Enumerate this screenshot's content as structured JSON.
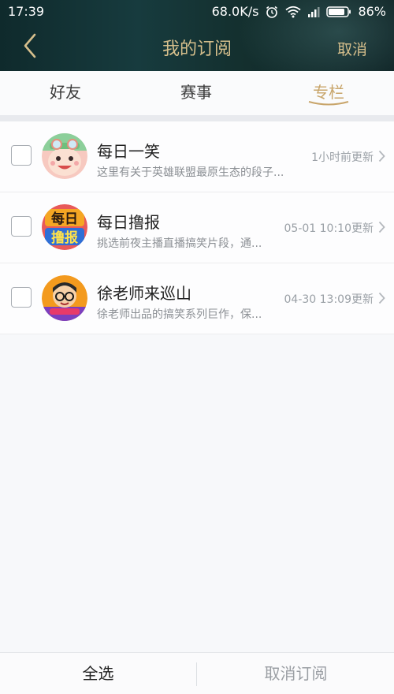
{
  "status_bar": {
    "time": "17:39",
    "network_speed": "68.0K/s",
    "battery": "86%",
    "icons": [
      "alarm-icon",
      "wifi-icon",
      "signal-icon",
      "battery-icon"
    ]
  },
  "header": {
    "title": "我的订阅",
    "cancel_label": "取消",
    "back_icon": "chevron-left-icon"
  },
  "tabs": [
    {
      "label": "好友",
      "active": false
    },
    {
      "label": "赛事",
      "active": false
    },
    {
      "label": "专栏",
      "active": true
    }
  ],
  "items": [
    {
      "title": "每日一笑",
      "description": "这里有关于英雄联盟最原生态的段子...",
      "updated": "1小时前更新",
      "checked": false
    },
    {
      "title": "每日撸报",
      "description": "挑选前夜主播直播搞笑片段，通...",
      "updated": "05-01 10:10更新",
      "checked": false
    },
    {
      "title": "徐老师来巡山",
      "description": "徐老师出品的搞笑系列巨作，保...",
      "updated": "04-30 13:09更新",
      "checked": false
    }
  ],
  "avatar_text": {
    "item_1_top": "每日",
    "item_1_bottom": "撸报"
  },
  "bottom_bar": {
    "select_all": "全选",
    "unsubscribe": "取消订阅"
  },
  "colors": {
    "accent_gold": "#c8a56a",
    "header_bg": "#173b3e"
  }
}
